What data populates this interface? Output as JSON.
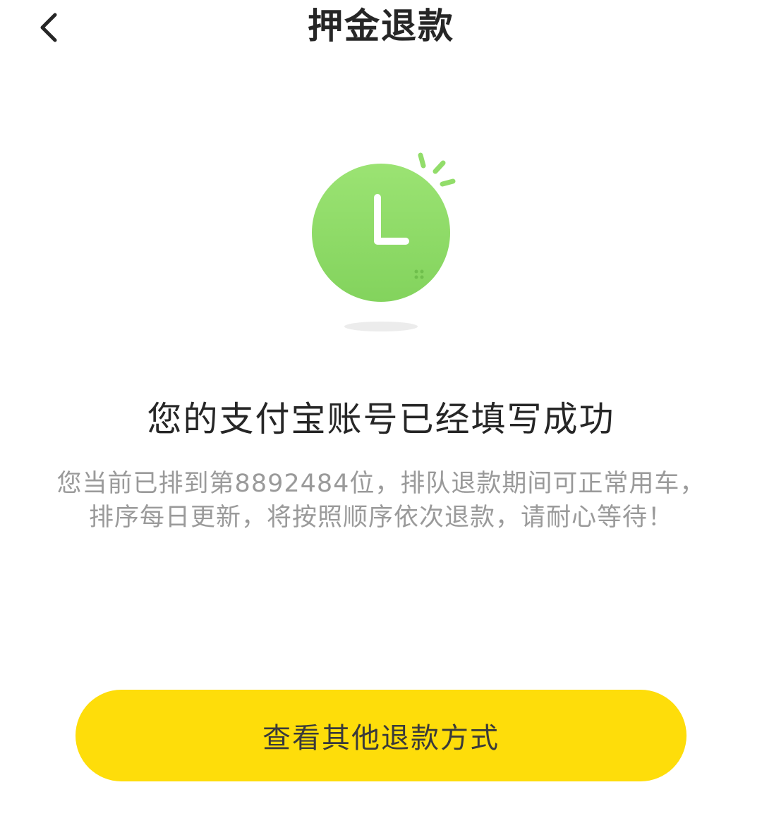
{
  "header": {
    "title": "押金退款",
    "back_icon": "chevron-left-icon"
  },
  "status": {
    "icon": "clock-icon",
    "icon_color": "#92dd6a",
    "heading": "您的支付宝账号已经填写成功",
    "message": "您当前已排到第8892484位，排队退款期间可正常用车，排序每日更新，将按照顺序依次退款，请耐心等待！"
  },
  "actions": {
    "other_refund_label": "查看其他退款方式",
    "button_color": "#fedd0a"
  }
}
